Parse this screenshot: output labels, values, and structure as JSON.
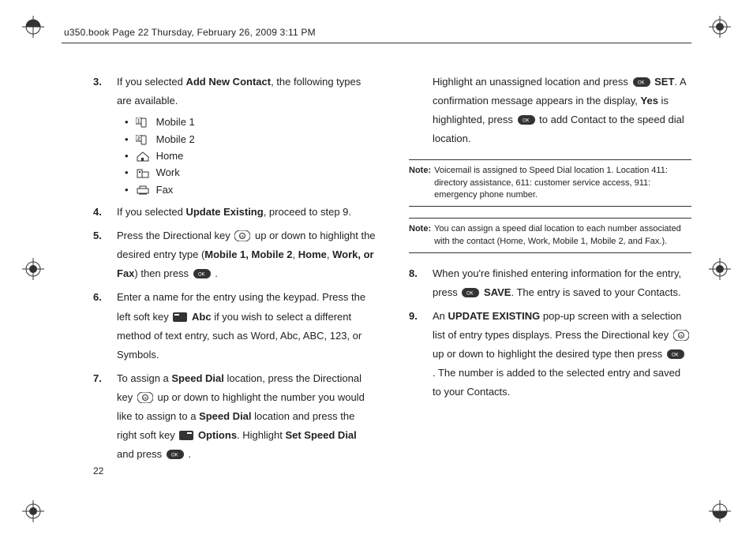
{
  "header": "u350.book  Page 22  Thursday, February 26, 2009  3:11 PM",
  "page_number": "22",
  "left": {
    "step3_pre": "If you selected ",
    "step3_bold": "Add New Contact",
    "step3_post": ", the following types are available.",
    "types": [
      "Mobile 1",
      "Mobile 2",
      "Home",
      "Work",
      "Fax"
    ],
    "step4_pre": "If you selected ",
    "step4_bold": "Update Existing",
    "step4_post": ", proceed to step 9.",
    "step5_a": "Press the Directional key ",
    "step5_b": " up or down to highlight the desired entry type (",
    "step5_b_bold": "Mobile 1, Mobile 2",
    "step5_b2": ", ",
    "step5_b_bold2": "Home",
    "step5_b3": ", ",
    "step5_b_bold3": "Work, or Fax",
    "step5_c": ") then press ",
    "step5_d": ".",
    "step6_a": "Enter a name for the entry using the keypad. Press the left soft key ",
    "step6_bold": "Abc",
    "step6_b": " if you wish to select a different method of text entry, such as Word, Abc, ABC, 123, or Symbols.",
    "step7_a": "To assign a ",
    "step7_bold1": "Speed Dial",
    "step7_b": " location, press the Directional key ",
    "step7_c": " up or down to highlight the number you would like to assign to a ",
    "step7_bold2": "Speed Dial",
    "step7_d": " location and press the right soft key ",
    "step7_bold3": "Options",
    "step7_e": ". Highlight ",
    "step7_bold4": "Set Speed Dial",
    "step7_f": " and press ",
    "step7_g": "."
  },
  "right": {
    "cont_a": "Highlight an unassigned location and press ",
    "cont_bold1": "SET",
    "cont_b": ". A confirmation message appears in the display, ",
    "cont_bold2": "Yes",
    "cont_c": " is highlighted, press ",
    "cont_d": " to add Contact to the speed dial location.",
    "note1_label": "Note:",
    "note1": "Voicemail is assigned to Speed Dial location 1. Location 411: directory assistance, 611: customer service access, 911: emergency phone number.",
    "note2_label": "Note:",
    "note2": "You can assign a speed dial location to each number associated with the contact (Home, Work, Mobile 1, Mobile 2, and Fax.).",
    "step8_a": "When you're finished entering information for the entry, press ",
    "step8_bold": "SAVE",
    "step8_b": ". The entry is saved to your Contacts.",
    "step9_a": "An ",
    "step9_bold1": "UPDATE EXISTING",
    "step9_b": " pop-up screen with a selection list of entry types displays. Press the Directional key ",
    "step9_c": " up or down to highlight the desired type then press ",
    "step9_d": ". The number is added to the selected entry and saved to your Contacts."
  },
  "nums": {
    "3": "3.",
    "4": "4.",
    "5": "5.",
    "6": "6.",
    "7": "7.",
    "8": "8.",
    "9": "9."
  }
}
